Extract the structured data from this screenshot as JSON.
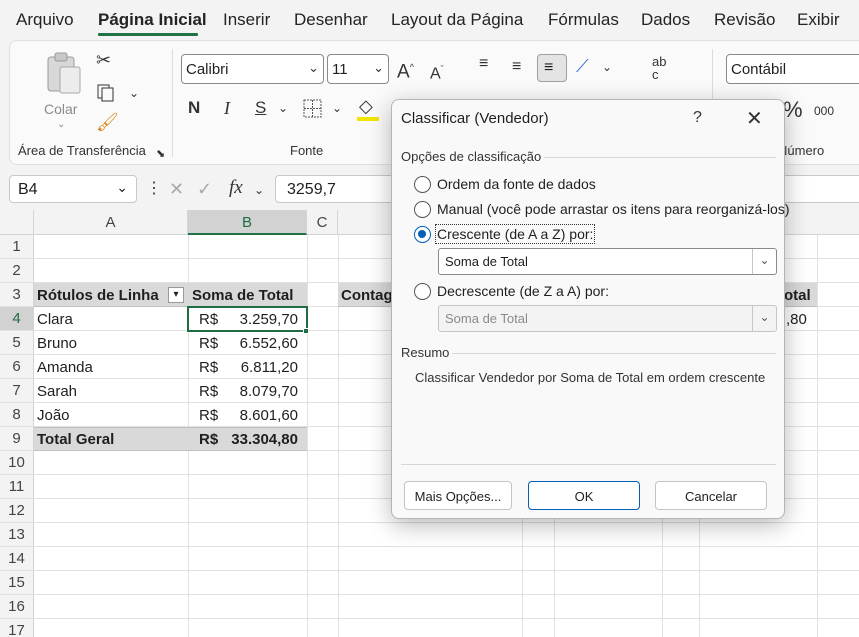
{
  "menu": {
    "tabs": [
      "Arquivo",
      "Página Inicial",
      "Inserir",
      "Desenhar",
      "Layout da Página",
      "Fórmulas",
      "Dados",
      "Revisão",
      "Exibir"
    ],
    "active": "Página Inicial"
  },
  "ribbon": {
    "clipboard": {
      "paste_label": "Colar",
      "group_label": "Área de Transferência"
    },
    "font": {
      "family": "Calibri",
      "size": "11",
      "group_label": "Fonte",
      "bold": "N",
      "italic": "I",
      "underline": "S"
    },
    "number": {
      "format": "Contábil",
      "group_label": "Número",
      "percent": "%",
      "thousands": "000"
    }
  },
  "formula_bar": {
    "name_box": "B4",
    "fx": "fx",
    "value": "3259,7"
  },
  "sheet": {
    "columns": [
      "A",
      "B",
      "C"
    ],
    "rows": [
      "1",
      "2",
      "3",
      "4",
      "5",
      "6",
      "7",
      "8",
      "9",
      "10",
      "11",
      "12",
      "13",
      "14",
      "15",
      "16",
      "17"
    ],
    "selected_cell": "B4",
    "pivot": {
      "header_row_label": "Rótulos de Linha",
      "header_value_label": "Soma de Total",
      "currency": "R$",
      "rows": [
        {
          "name": "Clara",
          "value": "3.259,70"
        },
        {
          "name": "Bruno",
          "value": "6.552,60"
        },
        {
          "name": "Amanda",
          "value": "6.811,20"
        },
        {
          "name": "Sarah",
          "value": "8.079,70"
        },
        {
          "name": "João",
          "value": "8.601,60"
        }
      ],
      "total_label": "Total Geral",
      "total_value": "33.304,80"
    },
    "second_pivot": {
      "header_left": "Contag",
      "header_right": "otal",
      "value": ",80"
    }
  },
  "dialog": {
    "title": "Classificar (Vendedor)",
    "help": "?",
    "options_label": "Opções de classificação",
    "options": [
      {
        "label": "Ordem da fonte de dados",
        "checked": false
      },
      {
        "label": "Manual (você pode arrastar os itens para reorganizá-los)",
        "checked": false
      },
      {
        "label": "Crescente (de A a Z) por:",
        "checked": true
      },
      {
        "label": "Decrescente (de Z a A) por:",
        "checked": false
      }
    ],
    "ascending_field": "Soma de Total",
    "descending_field": "Soma de Total",
    "summary_label": "Resumo",
    "summary_text": "Classificar Vendedor por Soma de Total em ordem crescente",
    "buttons": {
      "more": "Mais Opções...",
      "ok": "OK",
      "cancel": "Cancelar"
    }
  },
  "colors": {
    "accent_green": "#217346",
    "dialog_blue": "#005fb8",
    "header_band": "#d9d9d9"
  }
}
